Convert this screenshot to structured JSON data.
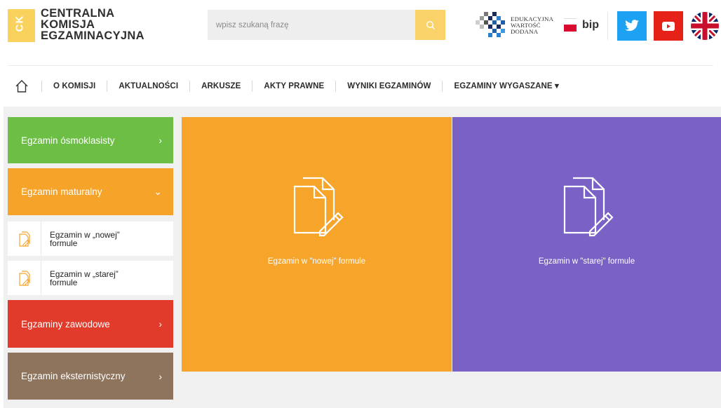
{
  "header": {
    "logo_mark": "CK",
    "logo_lines": [
      "CENTRALNA",
      "KOMISJA",
      "EGZAMINACYJNA"
    ],
    "search_placeholder": "wpisz szukaną frazę",
    "ewd_lines": [
      "EDUKACYJNA",
      "WARTOŚĆ",
      "DODANA"
    ],
    "bip_label": "bip"
  },
  "nav": {
    "items": [
      "O KOMISJI",
      "AKTUALNOŚCI",
      "ARKUSZE",
      "AKTY PRAWNE",
      "WYNIKI EGZAMINÓW",
      "EGZAMINY WYGASZANE"
    ],
    "dropdown_marker": "▾"
  },
  "sidebar": {
    "chevron_right": "›",
    "chevron_down": "⌄",
    "items": [
      {
        "label": "Egzamin ósmoklasisty",
        "color": "#6cbf44"
      },
      {
        "label": "Egzamin maturalny",
        "color": "#f6a32a"
      },
      {
        "label": "Egzaminy zawodowe",
        "color": "#e03b2b"
      },
      {
        "label": "Egzamin eksternistyczny",
        "color": "#8e735d"
      }
    ],
    "subitems": [
      "Egzamin w „nowej” formule",
      "Egzamin w „starej” formule"
    ]
  },
  "tiles": [
    {
      "label": "Egzamin w \"nowej\" formule",
      "color": "#f6a52a"
    },
    {
      "label": "Egzamin w \"starej\" formule",
      "color": "#7961c6"
    }
  ]
}
